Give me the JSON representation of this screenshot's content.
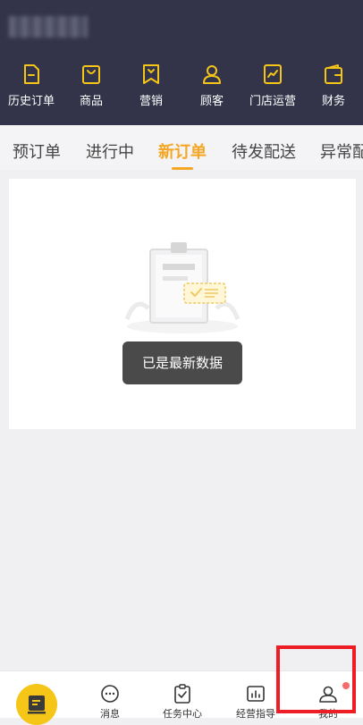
{
  "header": {
    "menu": [
      {
        "label": "历史订单",
        "icon": "history-orders-icon"
      },
      {
        "label": "商品",
        "icon": "shopping-bag-icon"
      },
      {
        "label": "营销",
        "icon": "marketing-icon"
      },
      {
        "label": "顾客",
        "icon": "customer-icon"
      },
      {
        "label": "门店运营",
        "icon": "store-operations-icon"
      },
      {
        "label": "财务",
        "icon": "wallet-icon"
      }
    ]
  },
  "tabs": {
    "items": [
      "预订单",
      "进行中",
      "新订单",
      "待发配送",
      "异常配"
    ],
    "active": "新订单"
  },
  "toast": {
    "text": "已是最新数据"
  },
  "bottom_nav": {
    "items": [
      {
        "label": "",
        "icon": "home-icon"
      },
      {
        "label": "消息",
        "icon": "message-icon"
      },
      {
        "label": "任务中心",
        "icon": "task-center-icon"
      },
      {
        "label": "经营指导",
        "icon": "business-guide-icon"
      },
      {
        "label": "我的",
        "icon": "profile-icon"
      }
    ]
  },
  "colors": {
    "header_bg": "#333449",
    "accent": "#f5a623",
    "home_button": "#f5c518",
    "badge": "#f56c6c",
    "highlight": "#ee1c24"
  }
}
